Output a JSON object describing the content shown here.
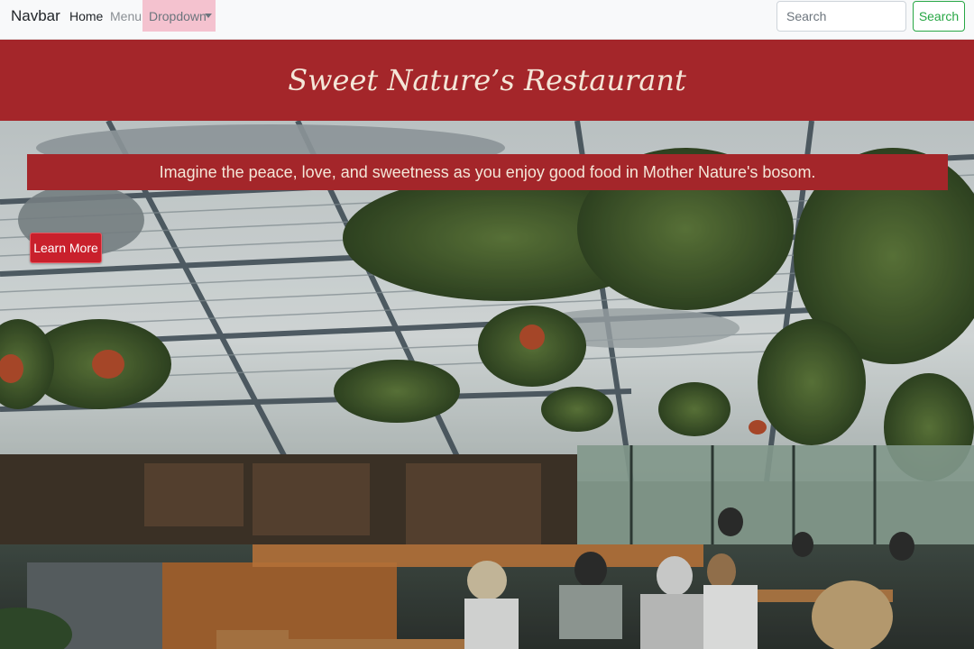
{
  "navbar": {
    "brand": "Navbar",
    "links": [
      {
        "label": "Home"
      },
      {
        "label": "Menu"
      }
    ],
    "dropdown_label": "Dropdown",
    "search_placeholder": "Search",
    "search_button": "Search"
  },
  "header": {
    "title": "Sweet Nature’s Restaurant"
  },
  "hero": {
    "tagline": "Imagine the peace, love, and sweetness as you enjoy good food in Mother Nature's bosom.",
    "cta_label": "Learn More"
  },
  "colors": {
    "banner": "#a4262a",
    "banner_text": "#f4e6d8",
    "cta": "#c9202c",
    "search_button": "#28a745",
    "dropdown_highlight": "#f4c2cf"
  }
}
